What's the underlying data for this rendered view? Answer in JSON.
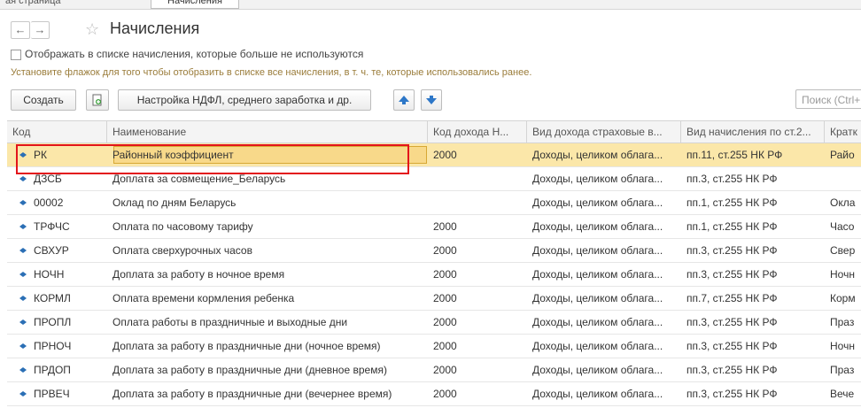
{
  "tabs": {
    "home_label": "ая страница",
    "active_label": "Начисления"
  },
  "header": {
    "title": "Начисления",
    "back_icon": "arrow-left-icon",
    "forward_icon": "arrow-right-icon",
    "favorite_icon": "star-icon"
  },
  "filter": {
    "checkbox_label": "Отображать в списке начисления, которые больше не используются",
    "checked": false,
    "hint": "Установите флажок для того чтобы отобразить в списке все начисления, в т. ч. те, которые использовались ранее."
  },
  "toolbar": {
    "create_label": "Создать",
    "ndfl_label": "Настройка НДФЛ, среднего заработка и др.",
    "search_placeholder": "Поиск (Ctrl+F)"
  },
  "table": {
    "columns": [
      "Код",
      "Наименование",
      "Код дохода Н...",
      "Вид дохода страховые в...",
      "Вид начисления по ст.2...",
      "Кратк"
    ],
    "rows": [
      {
        "code": "РК",
        "name": "Районный коэффициент",
        "income_code": "2000",
        "insurance": "Доходы, целиком облага...",
        "article": "пп.11, ст.255 НК РФ",
        "short": "Райо",
        "selected": true
      },
      {
        "code": "ДЗСБ",
        "name": "Доплата за совмещение_Беларусь",
        "income_code": "",
        "insurance": "Доходы, целиком облага...",
        "article": "пп.3, ст.255 НК РФ",
        "short": ""
      },
      {
        "code": "00002",
        "name": "Оклад по дням Беларусь",
        "income_code": "",
        "insurance": "Доходы, целиком облага...",
        "article": "пп.1, ст.255 НК РФ",
        "short": "Окла"
      },
      {
        "code": "ТРФЧС",
        "name": "Оплата по часовому тарифу",
        "income_code": "2000",
        "insurance": "Доходы, целиком облага...",
        "article": "пп.1, ст.255 НК РФ",
        "short": "Часо"
      },
      {
        "code": "СВХУР",
        "name": "Оплата сверхурочных часов",
        "income_code": "2000",
        "insurance": "Доходы, целиком облага...",
        "article": "пп.3, ст.255 НК РФ",
        "short": "Свер"
      },
      {
        "code": "НОЧН",
        "name": "Доплата за работу в ночное время",
        "income_code": "2000",
        "insurance": "Доходы, целиком облага...",
        "article": "пп.3, ст.255 НК РФ",
        "short": "Ночн"
      },
      {
        "code": "КОРМЛ",
        "name": "Оплата времени кормления ребенка",
        "income_code": "2000",
        "insurance": "Доходы, целиком облага...",
        "article": "пп.7, ст.255 НК РФ",
        "short": "Корм"
      },
      {
        "code": "ПРОПЛ",
        "name": "Оплата работы в праздничные и выходные дни",
        "income_code": "2000",
        "insurance": "Доходы, целиком облага...",
        "article": "пп.3, ст.255 НК РФ",
        "short": "Праз"
      },
      {
        "code": "ПРНОЧ",
        "name": "Доплата за работу в праздничные дни (ночное время)",
        "income_code": "2000",
        "insurance": "Доходы, целиком облага...",
        "article": "пп.3, ст.255 НК РФ",
        "short": "Ночн"
      },
      {
        "code": "ПРДОП",
        "name": "Доплата за работу в праздничные дни (дневное время)",
        "income_code": "2000",
        "insurance": "Доходы, целиком облага...",
        "article": "пп.3, ст.255 НК РФ",
        "short": "Праз"
      },
      {
        "code": "ПРВЕЧ",
        "name": "Доплата за работу в праздничные дни (вечернее время)",
        "income_code": "2000",
        "insurance": "Доходы, целиком облага...",
        "article": "пп.3, ст.255 НК РФ",
        "short": "Вече"
      }
    ]
  },
  "colors": {
    "selected_row": "#fbe7a9",
    "highlight_frame": "#e3141b",
    "row_marker": "#2b6fb5"
  }
}
